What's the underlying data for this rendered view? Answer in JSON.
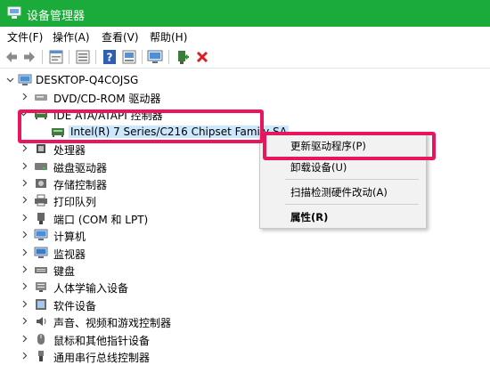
{
  "window": {
    "title": "设备管理器"
  },
  "menu": [
    "文件(F)",
    "操作(A)",
    "查看(V)",
    "帮助(H)"
  ],
  "toolbar": [
    "back-icon",
    "forward-icon",
    "properties-icon",
    "list-icon",
    "help-icon",
    "scan-icon",
    "monitor-icon",
    "enable-icon",
    "uninstall-icon"
  ],
  "tree": {
    "root": "DESKTOP-Q4COJSG",
    "items": [
      {
        "label": "DVD/CD-ROM 驱动器",
        "icon": "dvd-icon"
      },
      {
        "label": "IDE ATA/ATAPI 控制器",
        "icon": "ide-controller-icon",
        "expanded": true
      },
      {
        "label": "Intel(R) 7 Series/C216 Chipset Family SA",
        "icon": "ide-device-icon",
        "child": true,
        "selected": true
      },
      {
        "label": "处理器",
        "icon": "processor-icon"
      },
      {
        "label": "磁盘驱动器",
        "icon": "disk-icon"
      },
      {
        "label": "存储控制器",
        "icon": "storage-controller-icon"
      },
      {
        "label": "打印队列",
        "icon": "printer-icon"
      },
      {
        "label": "端口 (COM 和 LPT)",
        "icon": "port-icon"
      },
      {
        "label": "计算机",
        "icon": "computer-icon"
      },
      {
        "label": "监视器",
        "icon": "monitor-icon"
      },
      {
        "label": "键盘",
        "icon": "keyboard-icon"
      },
      {
        "label": "人体学输入设备",
        "icon": "hid-icon"
      },
      {
        "label": "软件设备",
        "icon": "software-device-icon"
      },
      {
        "label": "声音、视频和游戏控制器",
        "icon": "audio-icon"
      },
      {
        "label": "鼠标和其他指针设备",
        "icon": "mouse-icon"
      },
      {
        "label": "通用串行总线控制器",
        "icon": "usb-icon"
      }
    ]
  },
  "context_menu": {
    "update_driver": "更新驱动程序(P)",
    "uninstall": "卸载设备(U)",
    "scan": "扫描检测硬件改动(A)",
    "properties": "属性(R)"
  },
  "colors": {
    "titlebar": "#1aab3a",
    "highlight": "#e8175d",
    "selection": "#cce8ff"
  }
}
